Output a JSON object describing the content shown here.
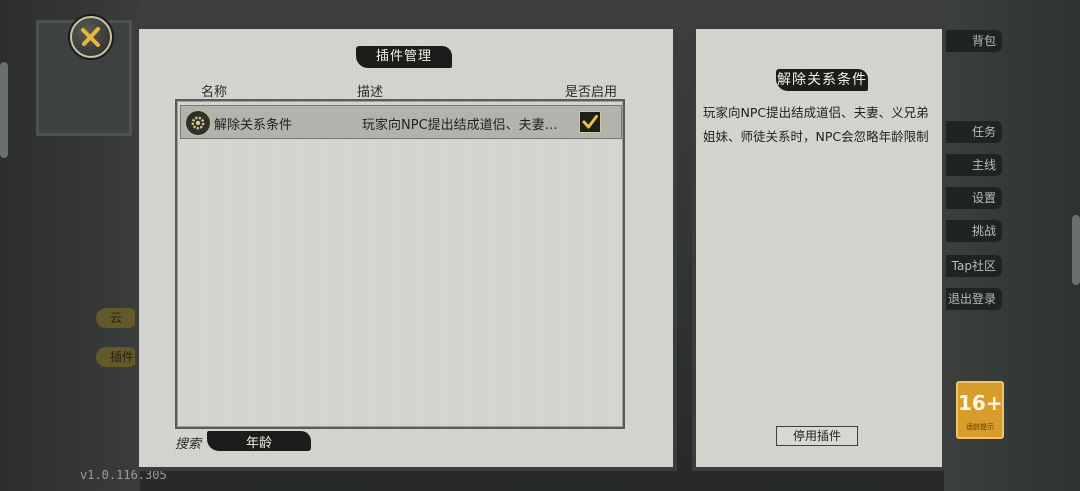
{
  "plugin_manager": {
    "title": "插件管理",
    "columns": {
      "name": "名称",
      "description": "描述",
      "enabled": "是否启用"
    },
    "plugins": [
      {
        "name": "解除关系条件",
        "description": "玩家向NPC提出结成道侣、夫妻…",
        "enabled": true
      }
    ],
    "search": {
      "label": "搜索",
      "value": "年龄"
    }
  },
  "detail": {
    "title": "解除关系条件",
    "description": "玩家向NPC提出结成道侣、夫妻、义兄弟姐妹、师徒关系时，NPC会忽略年龄限制",
    "disable_button": "停用插件"
  },
  "background": {
    "version": "v1.0.116.305",
    "right_buttons": [
      "背包",
      "任务",
      "主线",
      "设置",
      "挑战",
      "Tap社区",
      "退出登录"
    ],
    "left_pills": [
      "云",
      "插件"
    ],
    "age_rating": "16+",
    "age_rating_sub": "适龄提示"
  },
  "colors": {
    "panel": "#d5d4cf",
    "ink": "#1c1d1b",
    "accent_gold": "#d79c2b"
  }
}
